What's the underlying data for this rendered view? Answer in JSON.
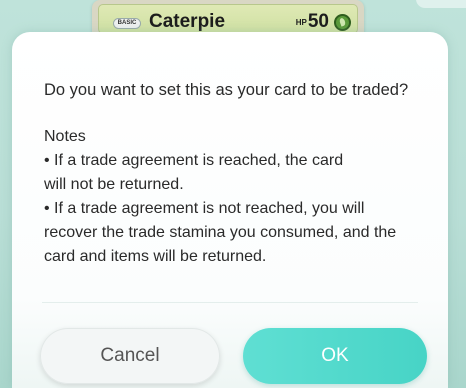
{
  "card": {
    "stage": "BASIC",
    "name": "Caterpie",
    "hp_label": "HP",
    "hp": "50",
    "type_icon": "grass-type-icon"
  },
  "dialog": {
    "question": "Do you want to set this as your card to be traded?",
    "notes_title": "Notes",
    "notes_line1a": "• If a trade agreement is reached, the card",
    "notes_line1b": "will not be returned.",
    "notes_line2a": "• If a trade agreement is not reached, you will",
    "notes_line2b": "recover the trade stamina you consumed, and the",
    "notes_line2c": "card and items will be returned."
  },
  "buttons": {
    "cancel": "Cancel",
    "ok": "OK"
  },
  "colors": {
    "ok_button": "#4fd8cb",
    "background": "#bfe3da"
  }
}
